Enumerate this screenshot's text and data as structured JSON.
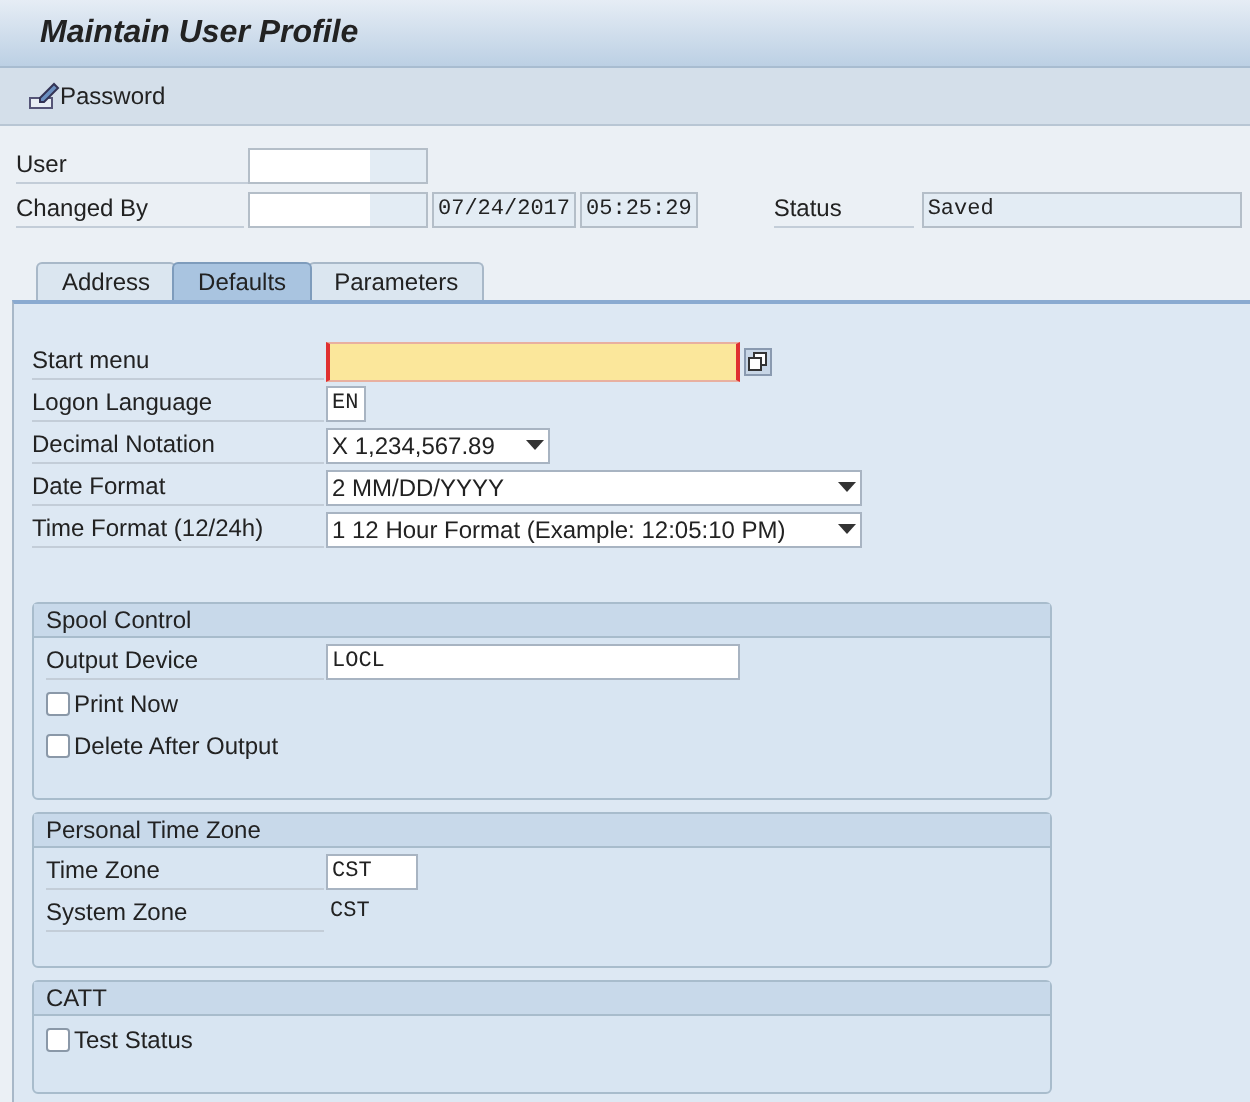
{
  "title": "Maintain User Profile",
  "toolbar": [
    {
      "label": "Password"
    }
  ],
  "header": {
    "user": {
      "label": "User"
    },
    "changed_by": {
      "label": "Changed By",
      "date": "07/24/2017",
      "time": "05:25:29"
    },
    "status": {
      "label": "Status",
      "value": "Saved"
    }
  },
  "tabs": [
    {
      "label": "Address",
      "selected": false
    },
    {
      "label": "Defaults",
      "selected": true
    },
    {
      "label": "Parameters",
      "selected": false
    }
  ],
  "defaults": [
    {
      "kind": "required",
      "label": "Start menu"
    },
    {
      "kind": "input",
      "label": "Logon Language",
      "value": "EN"
    },
    {
      "kind": "dropdown",
      "label": "Decimal Notation",
      "value": "X 1,234,567.89"
    },
    {
      "kind": "dropdown",
      "label": "Date Format",
      "value": "2 MM/DD/YYYY"
    },
    {
      "kind": "dropdown",
      "label": "Time Format (12/24h)",
      "value": "1 12 Hour Format (Example: 12:05:10 PM)"
    }
  ],
  "sections": [
    {
      "title": "Spool Control",
      "rows": [
        {
          "kind": "input",
          "label": "Output Device",
          "value": "LOCL"
        },
        {
          "kind": "checkbox",
          "label": "Print Now",
          "checked": false
        },
        {
          "kind": "checkbox",
          "label": "Delete After Output",
          "checked": false
        }
      ]
    },
    {
      "title": "Personal Time Zone",
      "rows": [
        {
          "kind": "input",
          "label": "Time Zone",
          "value": "CST"
        },
        {
          "kind": "text",
          "label": "System Zone",
          "value": "CST"
        }
      ]
    },
    {
      "title": "CATT",
      "rows": [
        {
          "kind": "checkbox",
          "label": "Test Status",
          "checked": false
        }
      ]
    }
  ]
}
